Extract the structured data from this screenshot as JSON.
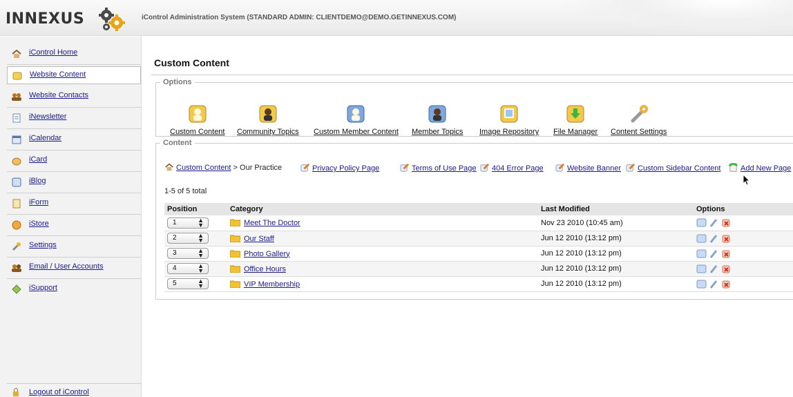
{
  "header": {
    "logo_text": "INNEXUS",
    "title": "iControl Administration System (STANDARD ADMIN: CLIENTDEMO@DEMO.GETINNEXUS.COM)"
  },
  "sidebar": {
    "items": [
      {
        "label": "iControl Home",
        "icon": "home-icon",
        "active": false
      },
      {
        "label": "Website Content",
        "icon": "website-content-icon",
        "active": true
      },
      {
        "label": "Website Contacts",
        "icon": "contacts-icon",
        "active": false
      },
      {
        "label": "iNewsletter",
        "icon": "newsletter-icon",
        "active": false
      },
      {
        "label": "iCalendar",
        "icon": "calendar-icon",
        "active": false
      },
      {
        "label": "iCard",
        "icon": "card-icon",
        "active": false
      },
      {
        "label": "iBlog",
        "icon": "blog-icon",
        "active": false
      },
      {
        "label": "iForm",
        "icon": "form-icon",
        "active": false
      },
      {
        "label": "iStore",
        "icon": "store-icon",
        "active": false
      },
      {
        "label": "Settings",
        "icon": "wrench-icon",
        "active": false
      },
      {
        "label": "Email / User Accounts",
        "icon": "users-icon",
        "active": false
      },
      {
        "label": "iSupport",
        "icon": "support-icon",
        "active": false
      }
    ],
    "logout_label": "Logout of iControl"
  },
  "main": {
    "title": "Custom Content",
    "options_legend": "Options",
    "options": [
      {
        "label": "Custom Content",
        "icon": "custom-content-icon"
      },
      {
        "label": "Community Topics",
        "icon": "community-topics-icon"
      },
      {
        "label": "Custom Member Content",
        "icon": "custom-member-content-icon"
      },
      {
        "label": "Member Topics",
        "icon": "member-topics-icon"
      },
      {
        "label": "Image Repository",
        "icon": "image-repository-icon"
      },
      {
        "label": "File Manager",
        "icon": "file-manager-icon"
      },
      {
        "label": "Content Settings",
        "icon": "content-settings-icon"
      }
    ],
    "content_legend": "Content",
    "breadcrumb": {
      "link": "Custom Content",
      "separator": " > ",
      "current": "Our Practice"
    },
    "page_links": [
      {
        "label": "Privacy Policy Page",
        "icon": "edit-page-icon"
      },
      {
        "label": "Terms of Use Page",
        "icon": "edit-page-icon"
      },
      {
        "label": "404 Error Page",
        "icon": "edit-page-icon"
      },
      {
        "label": "Website Banner",
        "icon": "edit-page-icon"
      },
      {
        "label": "Custom Sidebar Content",
        "icon": "edit-page-icon"
      },
      {
        "label": "Add New Page",
        "icon": "add-page-icon"
      }
    ],
    "count_text": "1-5 of 5 total",
    "table": {
      "headers": [
        "Position",
        "Category",
        "Last Modified",
        "Options"
      ],
      "rows": [
        {
          "position": "1",
          "category": "Meet The Doctor",
          "modified": "Nov 23 2010 (10:45 am)"
        },
        {
          "position": "2",
          "category": "Our Staff",
          "modified": "Jun 12 2010 (13:12 pm)"
        },
        {
          "position": "3",
          "category": "Photo Gallery",
          "modified": "Jun 12 2010 (13:12 pm)"
        },
        {
          "position": "4",
          "category": "Office Hours",
          "modified": "Jun 12 2010 (13:12 pm)"
        },
        {
          "position": "5",
          "category": "VIP Membership",
          "modified": "Jun 12 2010 (13:12 pm)"
        }
      ]
    }
  },
  "colors": {
    "link": "#1a1a8c",
    "header_bg": "#efefef",
    "sidebar_bg": "#f2f2f2",
    "table_header_bg": "#e5e5e5"
  }
}
